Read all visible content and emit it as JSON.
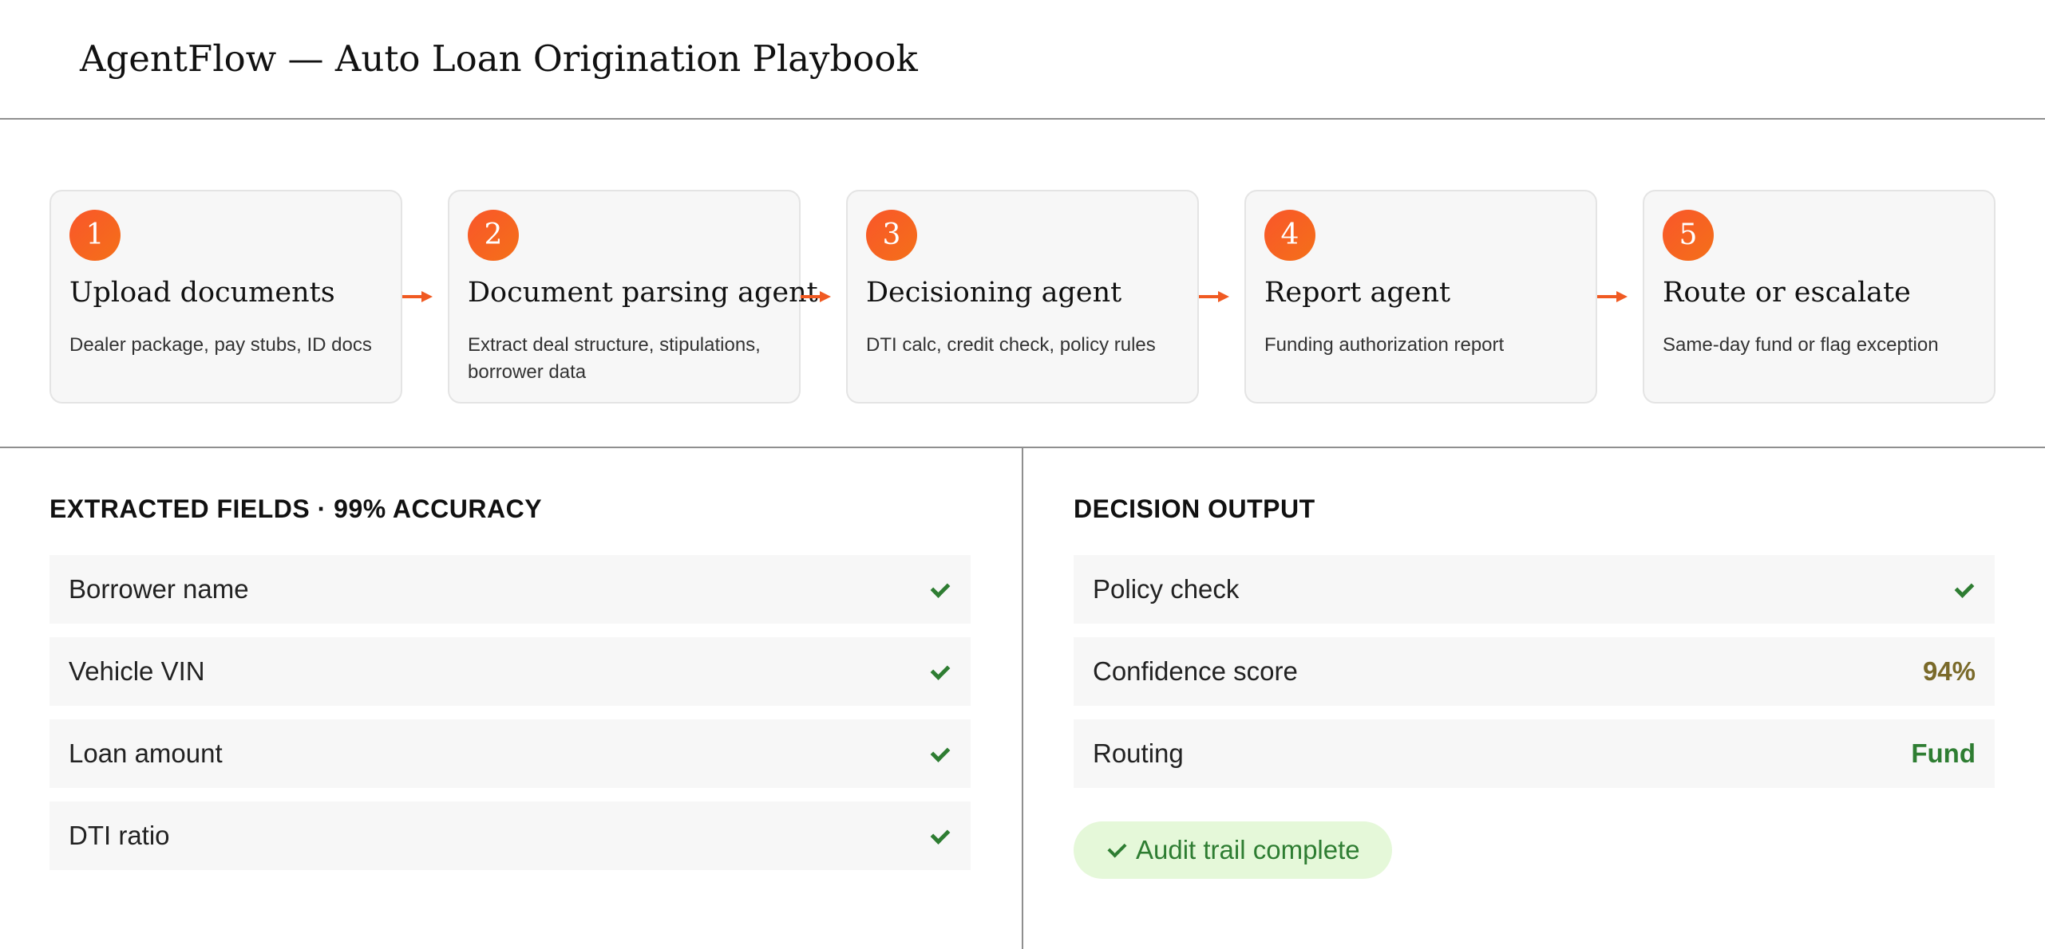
{
  "header": {
    "title": "AgentFlow — Auto Loan Origination Playbook"
  },
  "steps": [
    {
      "num": "1",
      "title": "Upload documents",
      "desc": "Dealer package, pay stubs, ID docs"
    },
    {
      "num": "2",
      "title": "Document parsing agent",
      "desc": "Extract deal structure, stipulations, borrower data"
    },
    {
      "num": "3",
      "title": "Decisioning agent",
      "desc": "DTI calc, credit check, policy rules"
    },
    {
      "num": "4",
      "title": "Report agent",
      "desc": "Funding authorization report"
    },
    {
      "num": "5",
      "title": "Route or escalate",
      "desc": "Same-day fund or flag exception"
    }
  ],
  "extracted": {
    "title": "EXTRACTED FIELDS · 99% ACCURACY",
    "rows": [
      {
        "label": "Borrower name",
        "status_icon": "check-icon"
      },
      {
        "label": "Vehicle VIN",
        "status_icon": "check-icon"
      },
      {
        "label": "Loan amount",
        "status_icon": "check-icon"
      },
      {
        "label": "DTI ratio",
        "status_icon": "check-icon"
      }
    ]
  },
  "decision": {
    "title": "DECISION OUTPUT",
    "rows": [
      {
        "label": "Policy check",
        "status_icon": "check-icon"
      },
      {
        "label": "Confidence score",
        "value": "94%",
        "value_color": "#7a6a2a"
      },
      {
        "label": "Routing",
        "value": "Fund",
        "value_color": "#2e7d32"
      }
    ],
    "badge": "Audit trail complete"
  },
  "colors": {
    "accent": "#f05a22",
    "success": "#2e7d32",
    "badge_bg": "#e5f8d9",
    "card_bg": "#f7f7f7"
  }
}
